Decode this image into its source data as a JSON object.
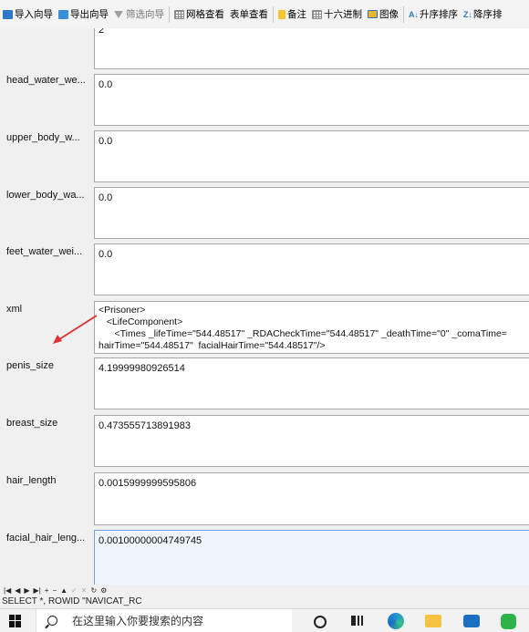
{
  "toolbar": {
    "items": [
      {
        "label": "导入向导",
        "icon": "import-icon"
      },
      {
        "label": "导出向导",
        "icon": "export-icon"
      },
      {
        "label": "筛选向导",
        "icon": "filter-icon"
      },
      {
        "label": "网格查看",
        "icon": "grid-view-icon"
      },
      {
        "label": "表单查看",
        "icon": "form-view-icon"
      },
      {
        "label": "备注",
        "icon": "note-icon"
      },
      {
        "label": "十六进制",
        "icon": "hex-icon"
      },
      {
        "label": "图像",
        "icon": "image-icon"
      },
      {
        "label": "升序排序",
        "icon": "sort-ascending-icon"
      },
      {
        "label": "降序排",
        "icon": "sort-descending-icon"
      }
    ]
  },
  "form": {
    "top_field_value": "2",
    "rows": [
      {
        "label": "head_water_we...",
        "value": "0.0"
      },
      {
        "label": "upper_body_w...",
        "value": "0.0"
      },
      {
        "label": "lower_body_wa...",
        "value": "0.0"
      },
      {
        "label": "feet_water_wei...",
        "value": "0.0"
      },
      {
        "label": "xml",
        "value": "<Prisoner>\n   <LifeComponent>\n      <Times _lifeTime=\"544.48517\" _RDACheckTime=\"544.48517\" _deathTime=\"0\" _comaTime=\nhairTime=\"544.48517\"  facialHairTime=\"544.48517\"/>"
      },
      {
        "label": "penis_size",
        "value": "4.19999980926514"
      },
      {
        "label": "breast_size",
        "value": "0.473555713891983"
      },
      {
        "label": "hair_length",
        "value": "0.0015999999595806"
      },
      {
        "label": "facial_hair_leng...",
        "value": "0.00100000004749745"
      }
    ]
  },
  "navigation": {
    "buttons": [
      "first-record",
      "previous-record",
      "next-record",
      "last-record",
      "add-record",
      "delete-record",
      "move-up",
      "apply",
      "cancel",
      "refresh",
      "settings"
    ]
  },
  "sql_bar": {
    "text": "SELECT *,  ROWID  \"NAVICAT_RC"
  },
  "taskbar": {
    "search_placeholder": "在这里输入你要搜索的内容"
  },
  "colors": {
    "focus_field_bg": "#eef5fd",
    "arrow": "#e03030"
  }
}
